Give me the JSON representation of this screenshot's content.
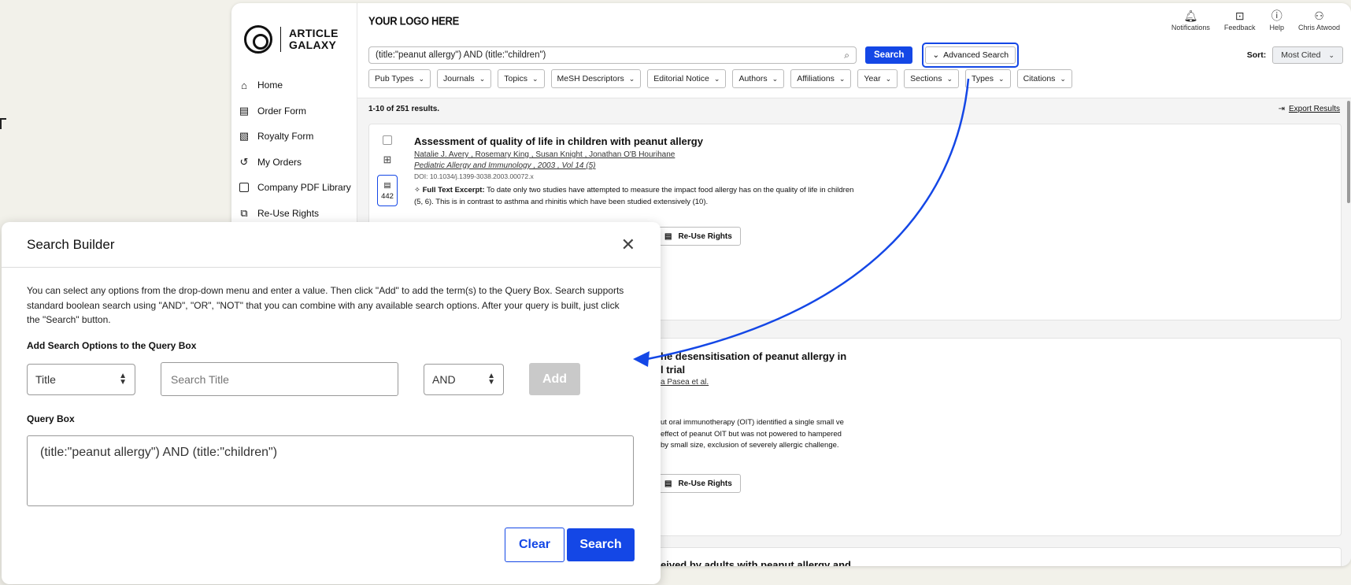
{
  "colors": {
    "accent": "#1447e6",
    "annotation_arrow": "#1447e6"
  },
  "sidebar": {
    "logo_text_1": "ARTICLE",
    "logo_text_2": "GALAXY",
    "items": [
      {
        "label": "Home",
        "icon": "home-icon"
      },
      {
        "label": "Order Form",
        "icon": "form-icon"
      },
      {
        "label": "Royalty Form",
        "icon": "royalty-form-icon"
      },
      {
        "label": "My Orders",
        "icon": "history-icon"
      },
      {
        "label": "Company PDF Library",
        "icon": "pdf-library-icon"
      },
      {
        "label": "Re-Use Rights",
        "icon": "copy-icon"
      }
    ]
  },
  "header": {
    "brand": "YOUR LOGO HERE",
    "actions": [
      {
        "label": "Notifications",
        "icon": "bell-icon"
      },
      {
        "label": "Feedback",
        "icon": "feedback-icon"
      },
      {
        "label": "Help",
        "icon": "help-icon"
      },
      {
        "label": "Chris Atwood",
        "icon": "user-icon"
      }
    ]
  },
  "search": {
    "query": "(title:\"peanut allergy\") AND (title:\"children\")",
    "button_label": "Search",
    "advanced_label": "Advanced Search",
    "sort_label": "Sort:",
    "sort_value": "Most Cited"
  },
  "filters": [
    "Pub Types",
    "Journals",
    "Topics",
    "MeSH Descriptors",
    "Editorial Notice",
    "Authors",
    "Affiliations",
    "Year",
    "Sections",
    "Types",
    "Citations"
  ],
  "results": {
    "count_text": "1-10 of 251 results.",
    "export_label": "Export Results",
    "reuse_label": "Re-Use Rights",
    "items": [
      {
        "title": "Assessment of quality of life in children with peanut allergy",
        "authors": "Natalie J. Avery , Rosemary King , Susan Knight , Jonathan O'B Hourihane",
        "journal": "Pediatric Allergy and Immunology , 2003 , Vol 14 (5)",
        "doi": "DOI: 10.1034/j.1399-3038.2003.00072.x",
        "excerpt_label": "Full Text Excerpt:",
        "excerpt": "To date only two studies have attempted to measure the impact food allergy has on the quality of life in children (5, 6). This is in contrast to asthma and rhinitis which have been studied extensively (10).",
        "citations": "442"
      },
      {
        "title_line1": "he desensitisation of peanut allergy in",
        "title_line2": "l trial",
        "authors": "a Pasea et al.",
        "excerpt": "ut oral immunotherapy (OIT) identified a single small ve effect of peanut OIT but was not powered to hampered by small size, exclusion of severely allergic challenge."
      },
      {
        "title": "eived by adults with peanut allergy and"
      }
    ]
  },
  "modal": {
    "title": "Search Builder",
    "intro": "You can select any options from the drop-down menu and enter a value. Then click \"Add\" to add the term(s) to the Query Box. Search supports standard boolean search using \"AND\", \"OR\", \"NOT\" that you can combine with any available search options. After your query is built, just click the \"Search\" button.",
    "options_label": "Add Search Options to the Query Box",
    "field_select": "Title",
    "term_placeholder": "Search Title",
    "operator_select": "AND",
    "add_label": "Add",
    "query_label": "Query Box",
    "query_value": "(title:\"peanut allergy\") AND (title:\"children\")",
    "clear_label": "Clear",
    "search_label": "Search"
  }
}
